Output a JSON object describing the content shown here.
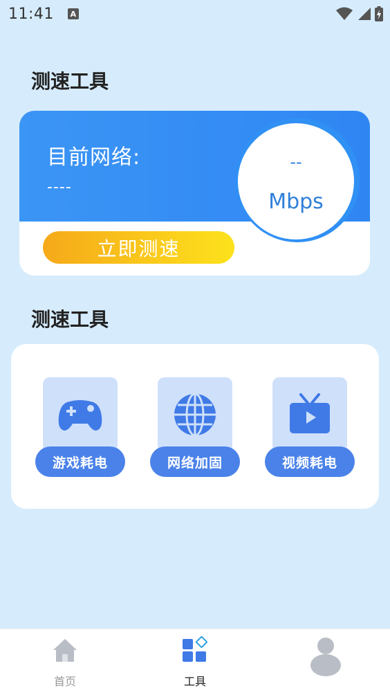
{
  "status_bar": {
    "time": "11:41",
    "notification_icon": "A"
  },
  "sections": {
    "title_1": "测速工具",
    "title_2": "测速工具"
  },
  "speed_card": {
    "network_label": "目前网络:",
    "network_value": "----",
    "speed_value": "--",
    "speed_unit": "Mbps",
    "test_button_label": "立即测速"
  },
  "tools": [
    {
      "label": "游戏耗电",
      "icon": "gamepad-icon"
    },
    {
      "label": "网络加固",
      "icon": "globe-icon"
    },
    {
      "label": "视频耗电",
      "icon": "tv-play-icon"
    }
  ],
  "bottom_nav": [
    {
      "label": "首页",
      "icon": "home-icon",
      "active": false
    },
    {
      "label": "工具",
      "icon": "tools-grid-icon",
      "active": true
    },
    {
      "label": "",
      "icon": "user-icon",
      "active": false
    }
  ],
  "colors": {
    "background": "#d6ecfd",
    "primary_blue": "#2f86f3",
    "tool_label_blue": "#4a82e9",
    "button_gradient_start": "#f6a91a",
    "button_gradient_end": "#fde21c"
  }
}
